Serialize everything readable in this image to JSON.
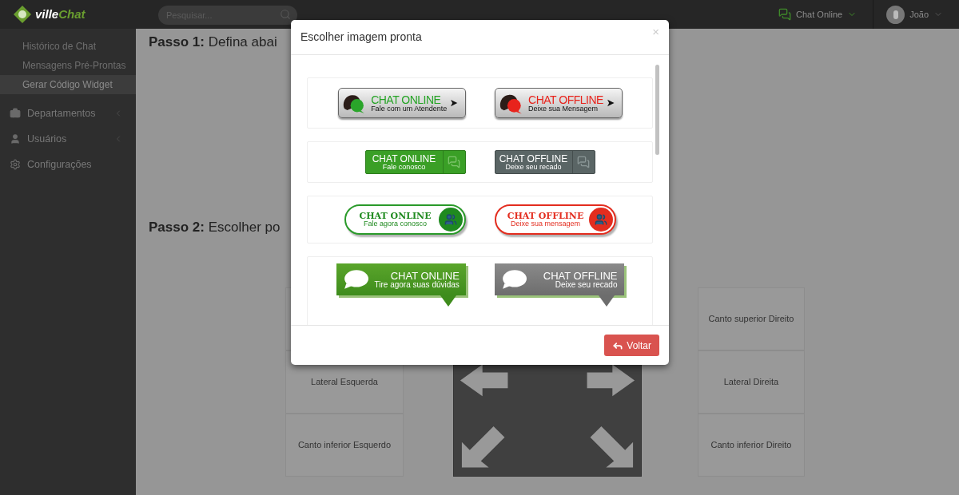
{
  "header": {
    "logo": [
      "ville",
      "Chat"
    ],
    "search": {
      "placeholder": "Pesquisar..."
    },
    "status": "Chat Online",
    "user": "João"
  },
  "sidebar": {
    "subitems": [
      {
        "label": "Histórico de Chat",
        "selected": false
      },
      {
        "label": "Mensagens Pré-Prontas",
        "selected": false
      },
      {
        "label": "Gerar Código Widget",
        "selected": true
      }
    ],
    "items": [
      {
        "label": "Departamentos",
        "kind": "briefcase",
        "has_submenu": true
      },
      {
        "label": "Usuários",
        "kind": "user",
        "has_submenu": true
      },
      {
        "label": "Configurações",
        "kind": "gears",
        "has_submenu": false
      }
    ]
  },
  "main": {
    "step1": "**Passo 1:** Defina abai",
    "step2": "**Passo 2:** Escolher po",
    "positions_left": [
      "Lateral Esquerda",
      "Canto inferior Esquerdo"
    ],
    "positions_right": [
      "Canto superior Direito",
      "Lateral Direita",
      "Canto inferior Direito"
    ]
  },
  "modal": {
    "title": "Escolher imagem pronta",
    "close": "×",
    "back_button": "Voltar",
    "rows": [
      {
        "kind": "bubble-arrow",
        "badges": [
          {
            "online": true,
            "title": "CHAT ONLINE",
            "subtitle": "Fale com um Atendente"
          },
          {
            "online": false,
            "title": "CHAT OFFLINE",
            "subtitle": "Deixe sua Mensagem"
          }
        ]
      },
      {
        "kind": "flat-tab",
        "badges": [
          {
            "online": true,
            "title": "CHAT ONLINE",
            "subtitle": "Fale conosco"
          },
          {
            "online": false,
            "title": "CHAT OFFLINE",
            "subtitle": "Deixe seu recado"
          }
        ]
      },
      {
        "kind": "pill",
        "badges": [
          {
            "online": true,
            "title": "CHAT ONLINE",
            "subtitle": "Fale agora conosco"
          },
          {
            "online": false,
            "title": "CHAT OFFLINE",
            "subtitle": "Deixe sua mensagem"
          }
        ]
      },
      {
        "kind": "speech",
        "badges": [
          {
            "online": true,
            "title": "CHAT ONLINE",
            "subtitle": "Tire agora suas dúvidas"
          },
          {
            "online": false,
            "title": "CHAT OFFLINE",
            "subtitle": "Deixe seu recado"
          }
        ]
      }
    ]
  }
}
